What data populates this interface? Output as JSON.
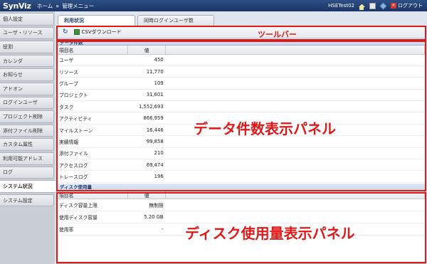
{
  "header": {
    "logo": "SynViz",
    "breadcrumb": [
      "ホーム",
      "管理メニュー"
    ],
    "breadcrumb_sep": "»",
    "user": "HSETest02",
    "logout": "ログアウト"
  },
  "sidebar": {
    "items": [
      {
        "label": "個人設定"
      },
      {
        "label": "ユーザ・リソース"
      },
      {
        "label": "役割"
      },
      {
        "label": "カレンダ"
      },
      {
        "label": "お知らせ"
      },
      {
        "label": "アドオン"
      },
      {
        "label": "ログインユーザ"
      },
      {
        "label": "プロジェクト削除"
      },
      {
        "label": "添付ファイル削除"
      },
      {
        "label": "カスタム属性"
      },
      {
        "label": "利用可能アドレス"
      },
      {
        "label": "ログ"
      },
      {
        "label": "システム状況"
      },
      {
        "label": "システム設定"
      }
    ],
    "active_index": 12
  },
  "tabs": [
    {
      "label": "利用状況",
      "active": true
    },
    {
      "label": "同時ログインユーザ数",
      "active": false
    }
  ],
  "toolbar": {
    "csv_label": "CSVダウンロード",
    "annotation": "ツールバー"
  },
  "data_panel": {
    "title": "データ件数",
    "col_item": "項目名",
    "col_value": "値",
    "rows": [
      {
        "name": "ユーザ",
        "value": "450"
      },
      {
        "name": "リソース",
        "value": "11,770"
      },
      {
        "name": "グループ",
        "value": "109"
      },
      {
        "name": "プロジェクト",
        "value": "31,601"
      },
      {
        "name": "タスク",
        "value": "1,552,693"
      },
      {
        "name": "アクティビティ",
        "value": "866,959"
      },
      {
        "name": "マイルストーン",
        "value": "16,446"
      },
      {
        "name": "実績情報",
        "value": "99,858"
      },
      {
        "name": "添付ファイル",
        "value": "210"
      },
      {
        "name": "アクセスログ",
        "value": "69,474"
      },
      {
        "name": "トレースログ",
        "value": "196"
      }
    ],
    "annotation": "データ件数表示パネル"
  },
  "disk_panel": {
    "title": "ディスク使用量",
    "col_item": "項目名",
    "col_value": "値",
    "rows": [
      {
        "name": "ディスク容量上限",
        "value": "無制限"
      },
      {
        "name": "使用ディスク容量",
        "value": "5.20 GB"
      },
      {
        "name": "使用率",
        "value": "-"
      }
    ],
    "annotation": "ディスク使用量表示パネル"
  },
  "colors": {
    "header_bg": "#1b3566",
    "annotation": "#e01818",
    "panel_title": "#1d3d6b"
  }
}
